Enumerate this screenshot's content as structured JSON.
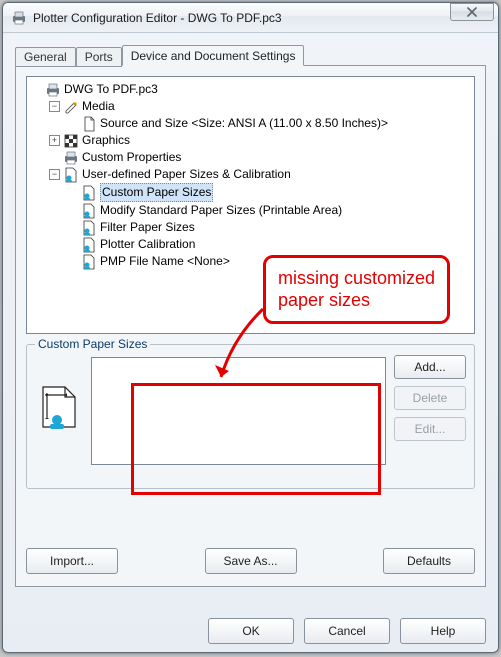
{
  "window": {
    "title": "Plotter Configuration Editor - DWG To PDF.pc3",
    "close_label": "Close"
  },
  "tabs": {
    "general": "General",
    "ports": "Ports",
    "device": "Device and Document Settings"
  },
  "tree": {
    "root": "DWG To PDF.pc3",
    "media": "Media",
    "source_size": "Source and Size <Size: ANSI A (11.00 x 8.50 Inches)>",
    "graphics": "Graphics",
    "custom_props": "Custom Properties",
    "user_defined": "User-defined Paper Sizes & Calibration",
    "custom_paper": "Custom Paper Sizes",
    "modify_std": "Modify Standard Paper Sizes (Printable Area)",
    "filter": "Filter Paper Sizes",
    "plotter_cal": "Plotter Calibration",
    "pmp": "PMP File Name <None>"
  },
  "group": {
    "title": "Custom Paper Sizes",
    "add": "Add...",
    "delete": "Delete",
    "edit": "Edit..."
  },
  "bottom": {
    "import": "Import...",
    "saveas": "Save As...",
    "defaults": "Defaults"
  },
  "dialog": {
    "ok": "OK",
    "cancel": "Cancel",
    "help": "Help"
  },
  "annotation": {
    "text": "missing customized paper sizes"
  }
}
